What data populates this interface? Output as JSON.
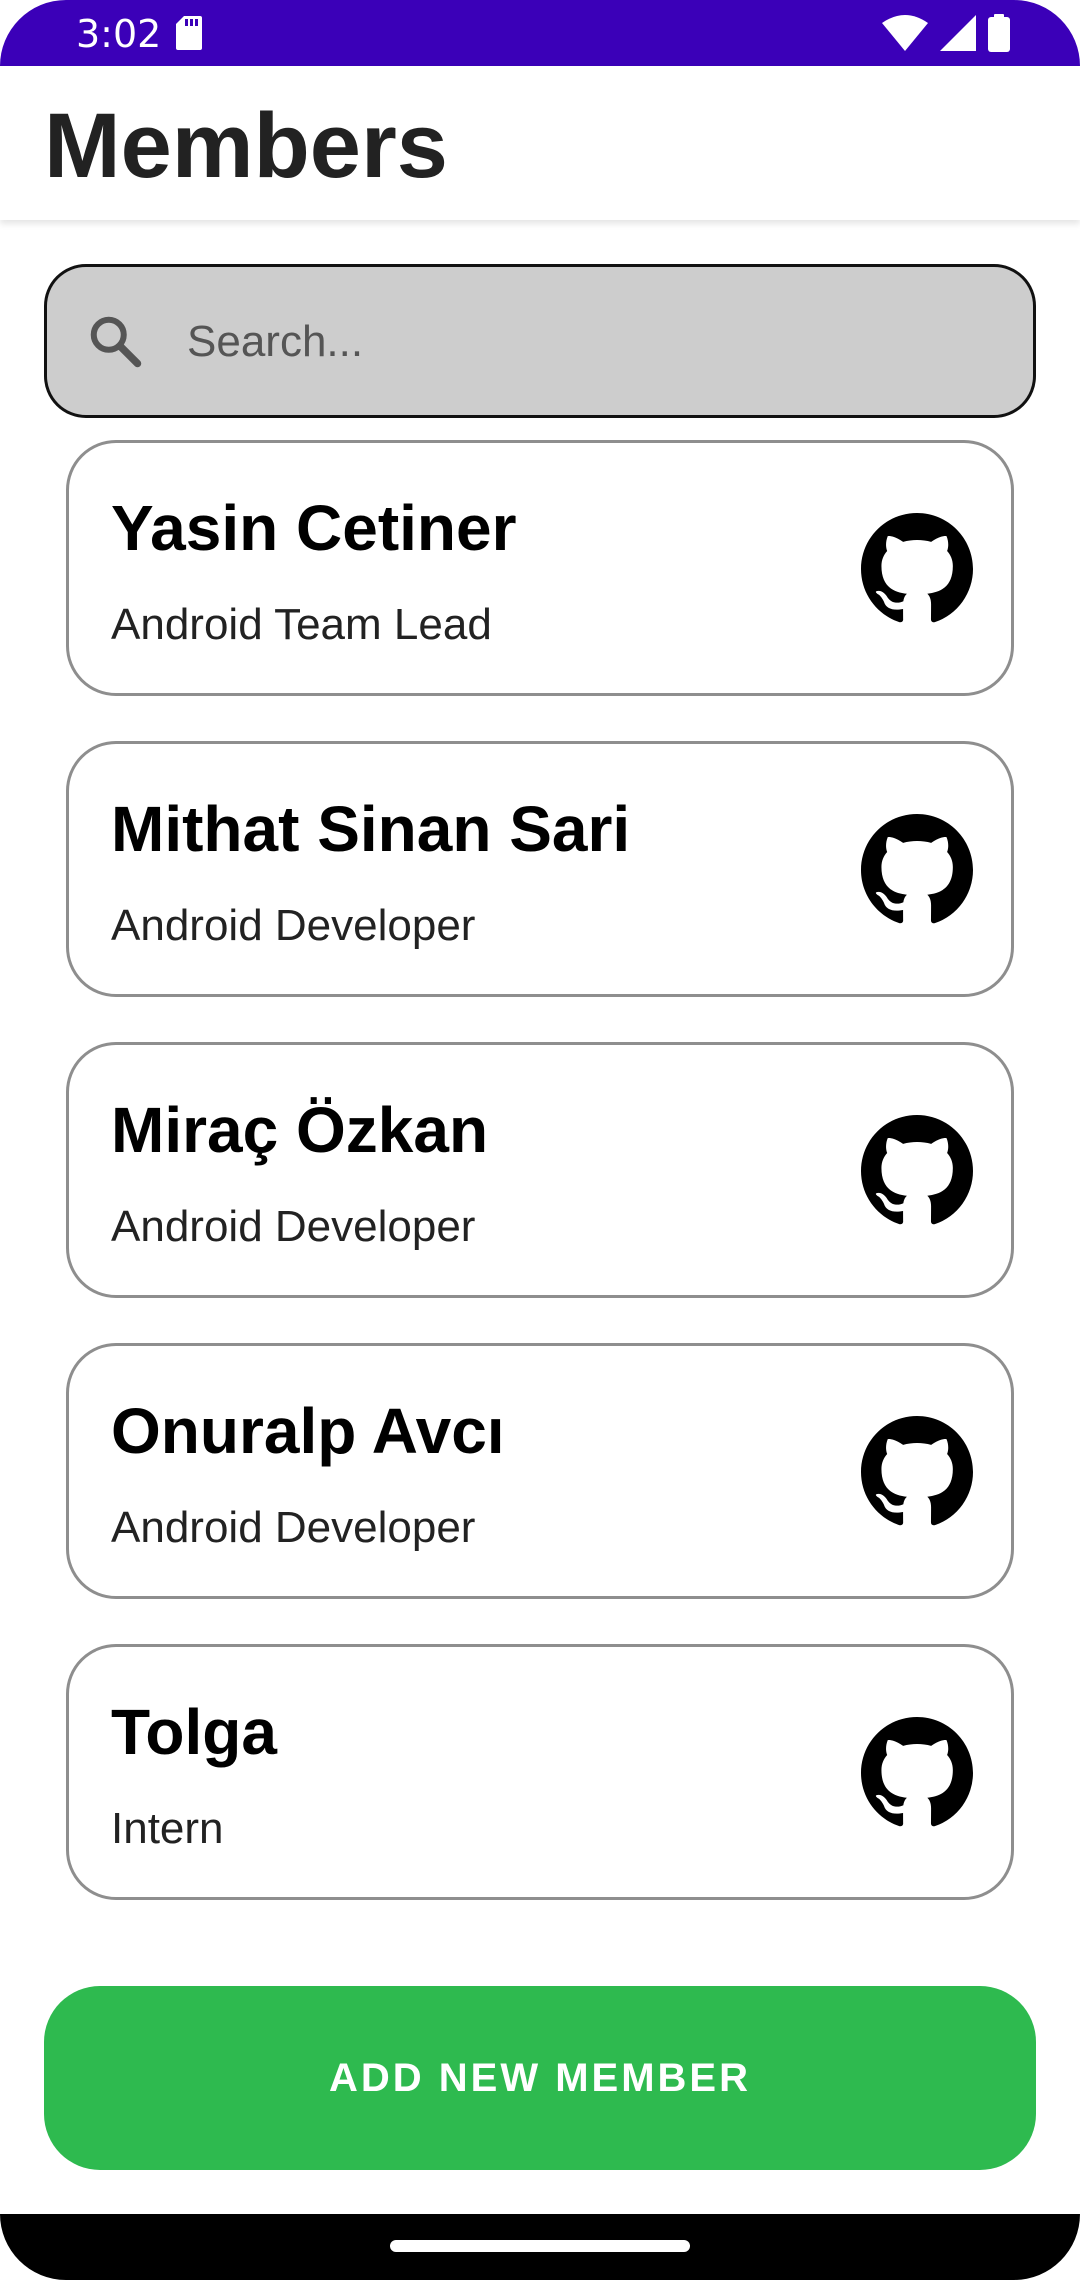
{
  "status_bar": {
    "time": "3:02",
    "background": "#3b00b8"
  },
  "app_bar": {
    "title": "Members"
  },
  "search": {
    "placeholder": "Search...",
    "value": "",
    "icon": "search-icon"
  },
  "members": [
    {
      "name": "Yasin Cetiner",
      "role": "Android Team Lead",
      "icon": "github-icon"
    },
    {
      "name": "Mithat Sinan Sari",
      "role": "Android Developer",
      "icon": "github-icon"
    },
    {
      "name": "Miraç Özkan",
      "role": "Android Developer",
      "icon": "github-icon"
    },
    {
      "name": "Onuralp Avcı",
      "role": "Android Developer",
      "icon": "github-icon"
    },
    {
      "name": "Tolga",
      "role": "Intern",
      "icon": "github-icon"
    }
  ],
  "actions": {
    "add_member_label": "ADD NEW MEMBER",
    "add_member_color": "#2eba4f"
  }
}
